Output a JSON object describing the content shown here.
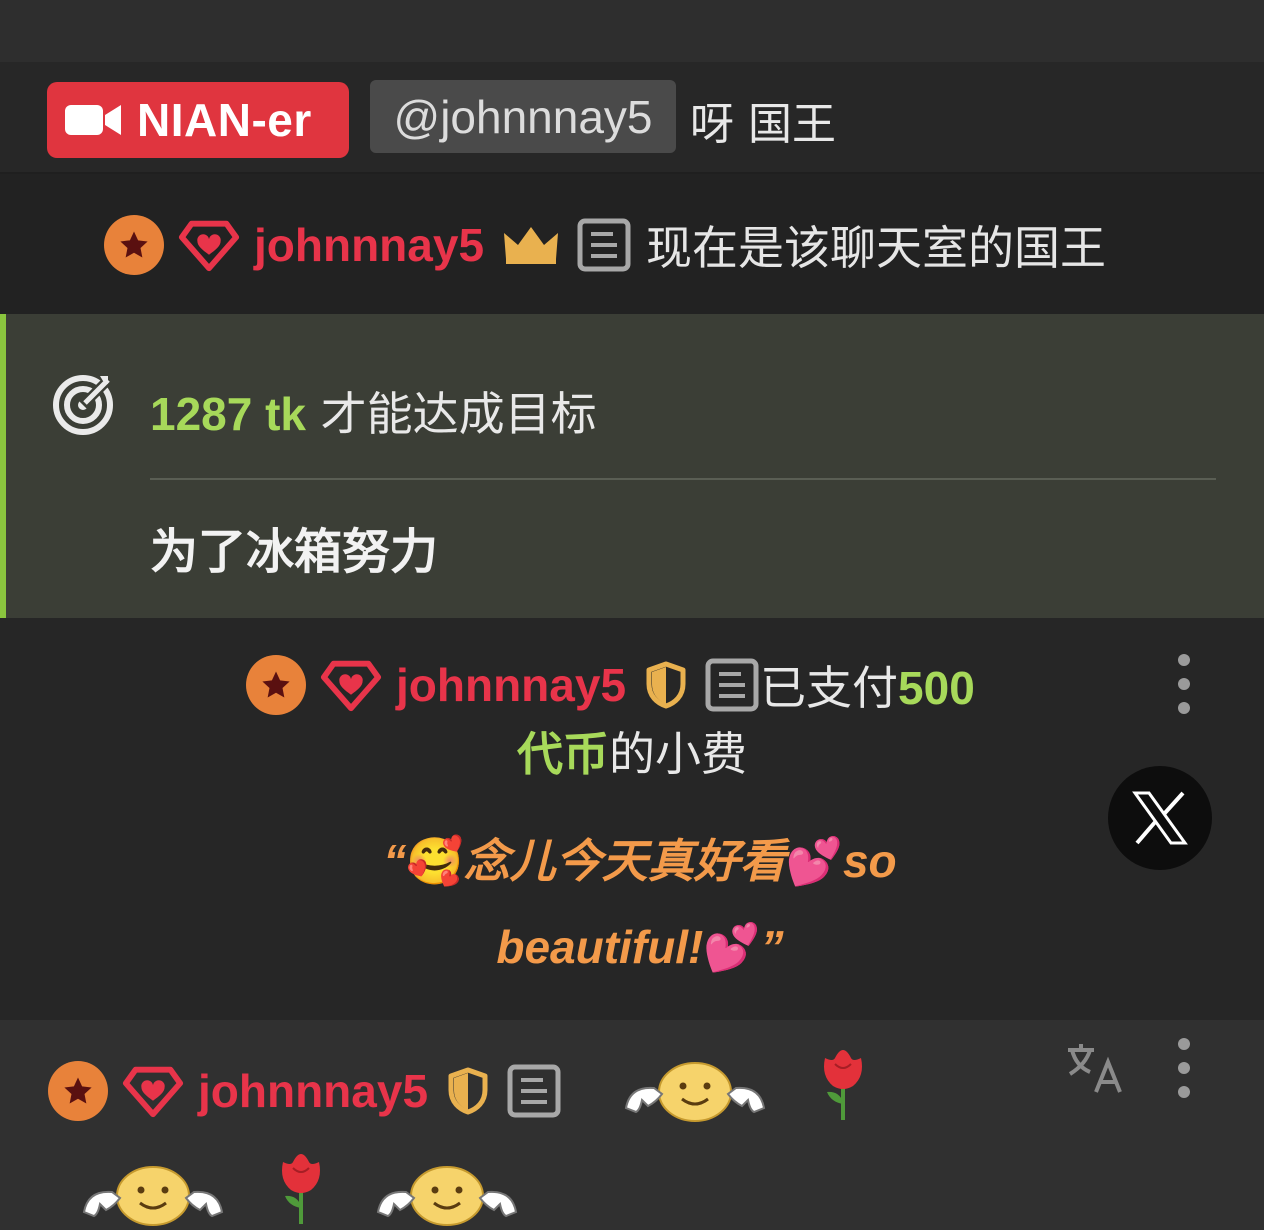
{
  "colors": {
    "live_badge": "#e0353f",
    "username": "#e8344a",
    "token_green": "#a7d95a",
    "goal_accent": "#8ac53e",
    "quote_orange": "#f39a4a",
    "star_badge": "#e8823a",
    "crown_gold": "#e9b14f"
  },
  "live_row": {
    "badge_icon": "video-camera-icon",
    "model_name": "NIAN-er",
    "mention": "@johnnnay5",
    "message": "呀 国王"
  },
  "king_row": {
    "username": "johnnnay5",
    "icons": [
      "star-badge-icon",
      "gem-heart-icon",
      "crown-icon",
      "document-icon"
    ],
    "message": "现在是该聊天室的国王"
  },
  "goal": {
    "icon": "target-icon",
    "tokens": "1287 tk",
    "text": "才能达成目标",
    "description": "为了冰箱努力"
  },
  "tip_row": {
    "username": "johnnnay5",
    "icons": [
      "star-badge-icon",
      "gem-heart-icon",
      "shield-icon",
      "document-icon"
    ],
    "paid_prefix": "已支付",
    "amount": "500",
    "currency": "代币",
    "suffix": "的小费",
    "quote_open": "“",
    "quote_emoji_1": "🥰",
    "quote_text_1": "念儿今天真好看",
    "quote_emoji_2": "💕",
    "quote_text_2": "so beautiful!",
    "quote_emoji_3": "💕",
    "quote_close": "”",
    "x_button_icon": "x-logo-icon"
  },
  "last_row": {
    "username": "johnnnay5",
    "icons": [
      "star-badge-icon",
      "gem-heart-icon",
      "shield-icon",
      "document-icon",
      "translate-icon",
      "kebab-menu-icon"
    ],
    "emotes": [
      "smiley-emote",
      "rose-emote",
      "smiley-emote",
      "rose-emote",
      "smiley-emote"
    ]
  }
}
